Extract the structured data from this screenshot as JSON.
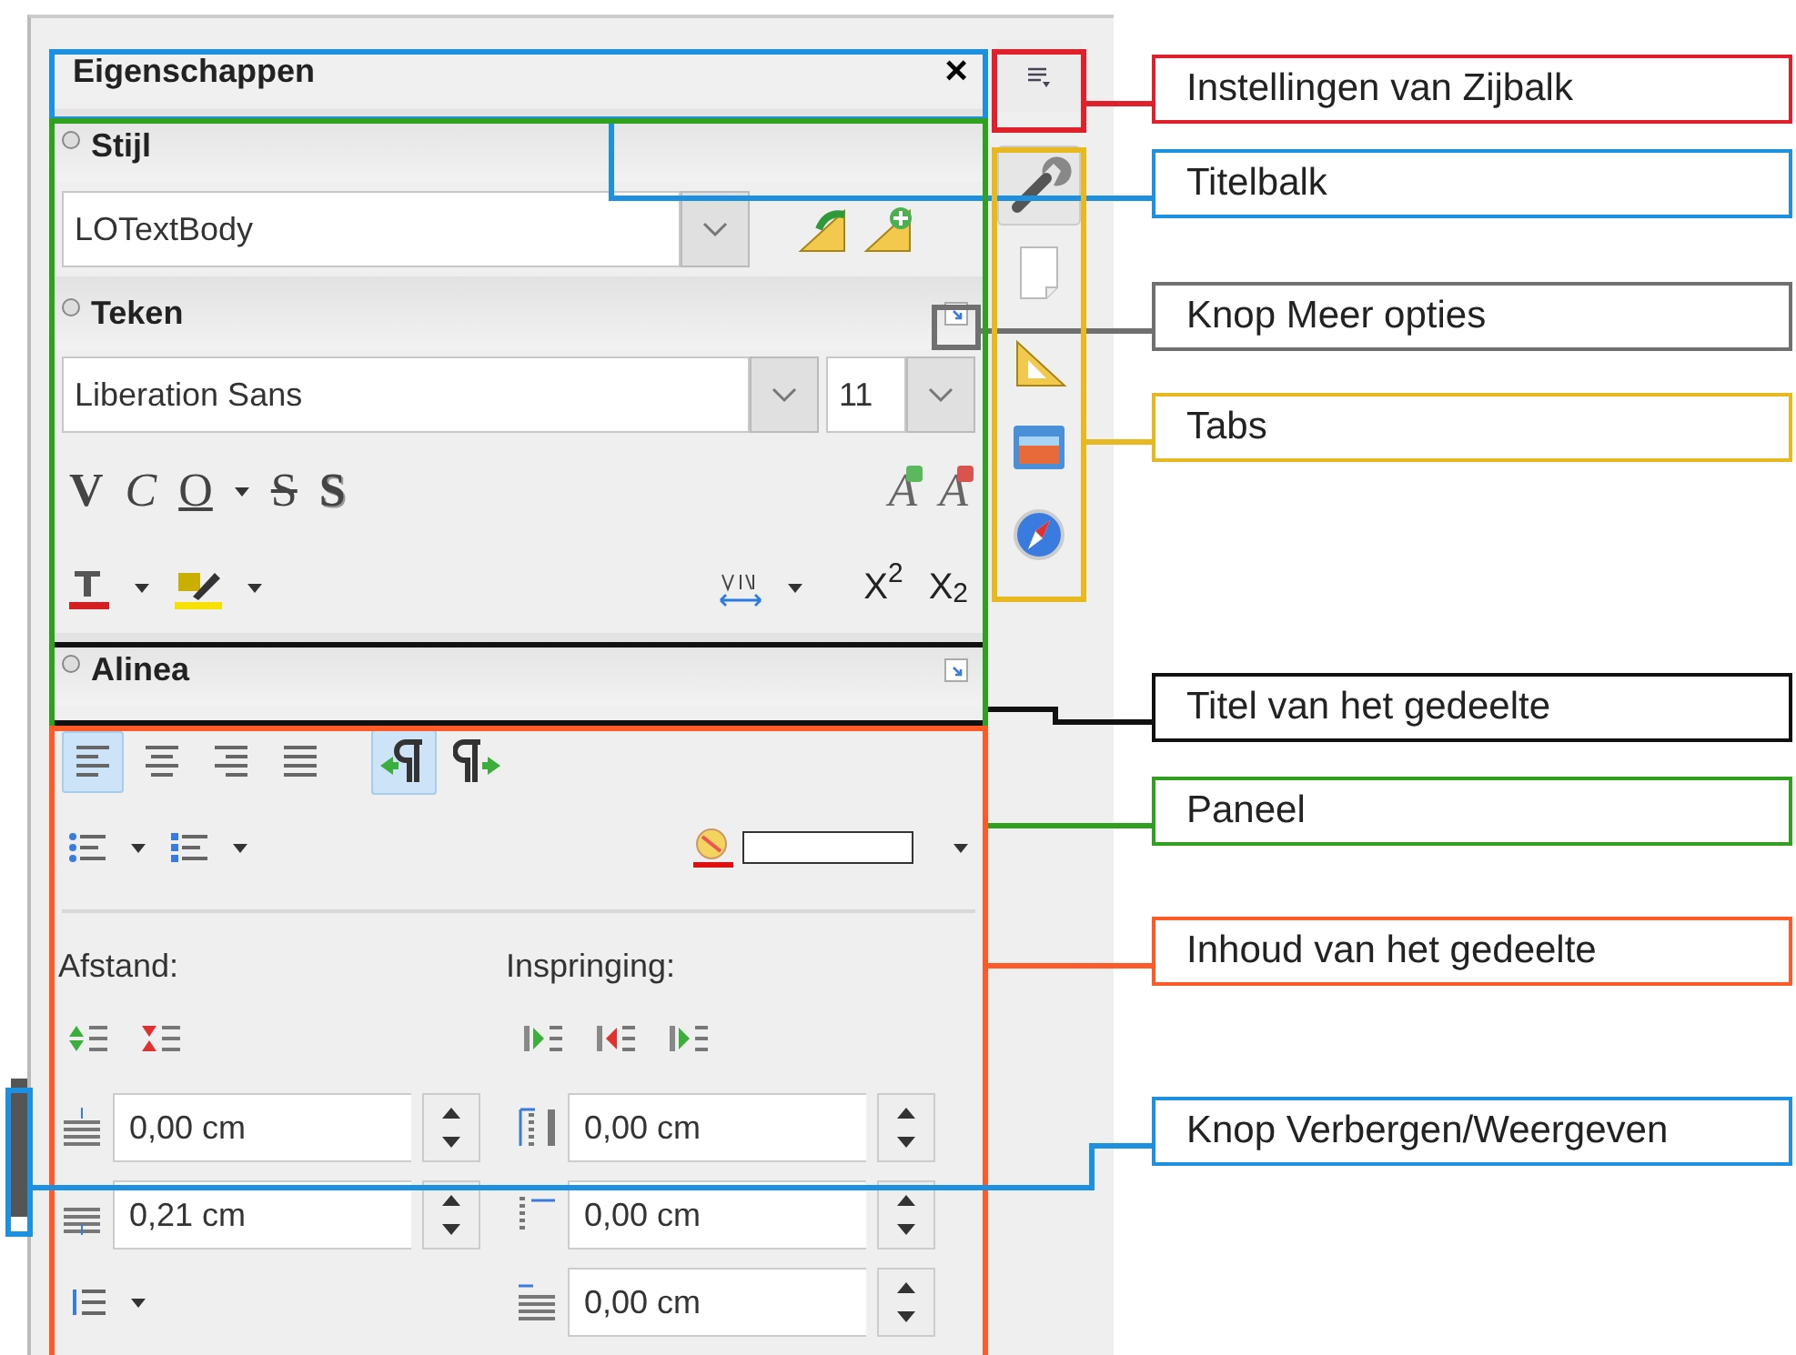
{
  "sidebar": {
    "title": "Eigenschappen",
    "close_glyph": "×",
    "tabs": [
      {
        "kind": "properties",
        "selected": true
      },
      {
        "kind": "page",
        "selected": false
      },
      {
        "kind": "styles",
        "selected": false
      },
      {
        "kind": "gallery",
        "selected": false
      },
      {
        "kind": "navigator",
        "selected": false
      }
    ],
    "sections": [
      {
        "kind": "style",
        "title": "Stijl",
        "style": "LOTextBody"
      },
      {
        "kind": "character",
        "title": "Teken",
        "font": "Liberation Sans",
        "size": "11",
        "format_buttons": [
          {
            "kind": "bold",
            "glyph": "V"
          },
          {
            "kind": "italic",
            "glyph": "C"
          },
          {
            "kind": "underline",
            "glyph": "O"
          },
          {
            "kind": "strike",
            "glyph": "S"
          },
          {
            "kind": "shadow",
            "glyph": "S"
          }
        ],
        "size_buttons": [
          {
            "kind": "grow",
            "glyph": "A"
          },
          {
            "kind": "shrink",
            "glyph": "A"
          }
        ],
        "scripts": [
          "X$^{2}$",
          "X$_{2}$"
        ]
      },
      {
        "kind": "paragraph",
        "title": "Alinea",
        "alignments": [
          {
            "selected": true
          },
          {
            "selected": false
          },
          {
            "selected": false
          },
          {
            "selected": false
          }
        ],
        "directions": [
          {
            "selected": true
          },
          {
            "selected": false
          }
        ],
        "spacing_label": "Afstand:",
        "indent_label": "Inspringing:",
        "spacing_values": [
          "0,00 cm",
          "0,21 cm"
        ],
        "indent_values": [
          "0,00 cm",
          "0,00 cm",
          "0,00 cm"
        ]
      }
    ]
  },
  "callouts": [
    {
      "kind": "settings",
      "label": "Instellingen van Zijbalk",
      "color": "#e0202a"
    },
    {
      "kind": "titlebar",
      "label": "Titelbalk",
      "color": "#1e90e0"
    },
    {
      "kind": "more-options",
      "label": "Knop Meer opties",
      "color": "#707070"
    },
    {
      "kind": "tabs",
      "label": "Tabs",
      "color": "#e8b820"
    },
    {
      "kind": "section-title",
      "label": "Titel van het gedeelte",
      "color": "#111111"
    },
    {
      "kind": "panel",
      "label": "Paneel",
      "color": "#30a020"
    },
    {
      "kind": "content",
      "label": "Inhoud van het gedeelte",
      "color": "#ff5a28"
    },
    {
      "kind": "hide-button",
      "label": "Knop Verbergen/Weergeven",
      "color": "#1e90e0"
    }
  ]
}
